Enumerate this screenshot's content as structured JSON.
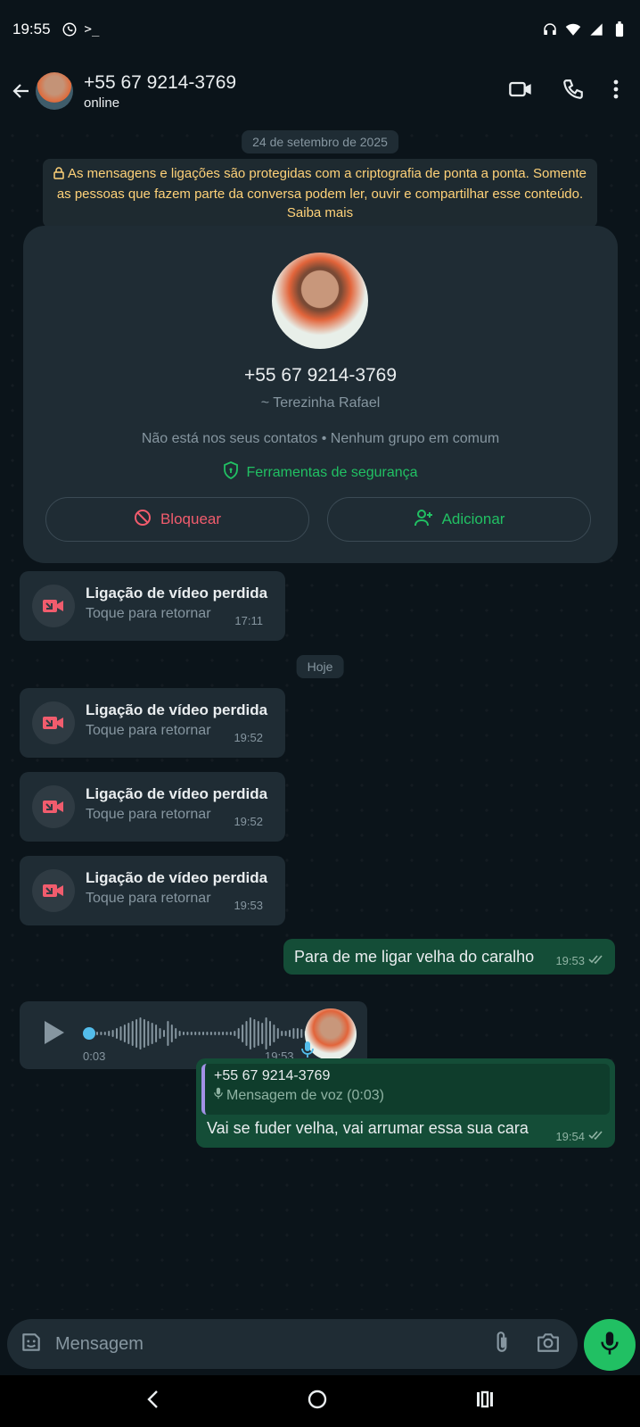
{
  "status_bar": {
    "time": "19:55",
    "prompt_glyph": ">_"
  },
  "header": {
    "title": "+55 67 9214-3769",
    "subtitle": "online"
  },
  "chat": {
    "date_first": "24 de setembro de 2025",
    "encryption_notice": "As mensagens e ligações são protegidas com a criptografia de ponta a ponta. Somente as pessoas que fazem parte da conversa podem ler, ouvir e compartilhar esse conteúdo. Saiba mais",
    "contact_card": {
      "number": "+55 67 9214-3769",
      "alias": "~ Terezinha Rafael",
      "info": "Não está nos seus contatos • Nenhum grupo em comum",
      "security_tools": "Ferramentas de segurança",
      "block_label": "Bloquear",
      "add_label": "Adicionar"
    },
    "date_today": "Hoje",
    "missed_calls": [
      {
        "title": "Ligação de vídeo perdida",
        "subtitle": "Toque para retornar",
        "time": "17:11"
      },
      {
        "title": "Ligação de vídeo perdida",
        "subtitle": "Toque para retornar",
        "time": "19:52"
      },
      {
        "title": "Ligação de vídeo perdida",
        "subtitle": "Toque para retornar",
        "time": "19:52"
      },
      {
        "title": "Ligação de vídeo perdida",
        "subtitle": "Toque para retornar",
        "time": "19:53"
      }
    ],
    "outgoing_1": {
      "text": "Para de me ligar velha do caralho",
      "time": "19:53"
    },
    "voice_note": {
      "duration": "0:03",
      "time": "19:53",
      "progress": 0.0
    },
    "reply": {
      "quoted_author": "+55 67 9214-3769",
      "quoted_text": "Mensagem de voz (0:03)",
      "text": "Vai se fuder velha, vai arrumar essa sua cara",
      "time": "19:54"
    }
  },
  "input": {
    "placeholder": "Mensagem"
  },
  "colors": {
    "accent": "#21c063",
    "outgoing_bubble": "#144d37",
    "incoming_bubble": "#1f2c34",
    "danger": "#f15c6d",
    "notice": "#ffd279"
  }
}
